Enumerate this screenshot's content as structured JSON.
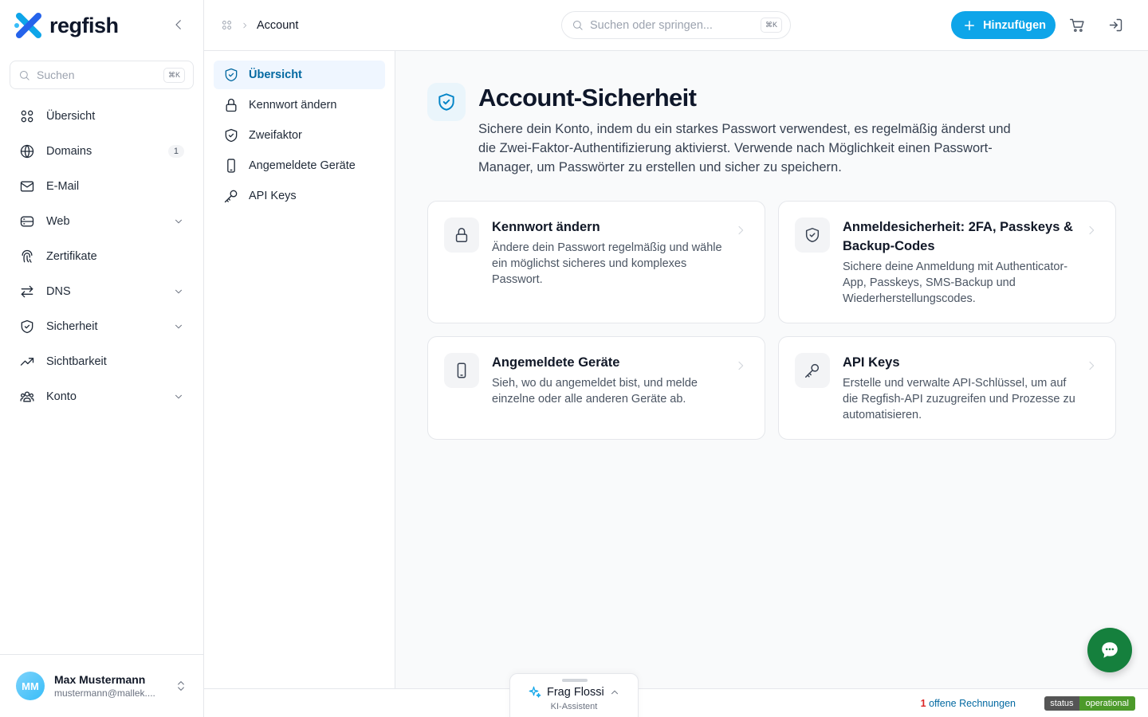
{
  "brand": {
    "name": "regfish"
  },
  "sidebar": {
    "search_placeholder": "Suchen",
    "search_shortcut": "⌘K",
    "items": [
      {
        "label": "Übersicht",
        "icon": "grid-icon"
      },
      {
        "label": "Domains",
        "icon": "globe-icon",
        "badge": "1"
      },
      {
        "label": "E-Mail",
        "icon": "mail-icon"
      },
      {
        "label": "Web",
        "icon": "server-icon",
        "expandable": true
      },
      {
        "label": "Zertifikate",
        "icon": "fingerprint-icon"
      },
      {
        "label": "DNS",
        "icon": "arrows-icon",
        "expandable": true
      },
      {
        "label": "Sicherheit",
        "icon": "shield-icon",
        "expandable": true
      },
      {
        "label": "Sichtbarkeit",
        "icon": "trend-icon"
      },
      {
        "label": "Konto",
        "icon": "users-icon",
        "expandable": true
      }
    ]
  },
  "user": {
    "initials": "MM",
    "name": "Max Mustermann",
    "email": "mustermann@mallek...."
  },
  "topbar": {
    "breadcrumb": "Account",
    "search_placeholder": "Suchen oder springen...",
    "search_shortcut": "⌘K",
    "add_label": "Hinzufügen"
  },
  "subnav": {
    "items": [
      {
        "label": "Übersicht",
        "active": true
      },
      {
        "label": "Kennwort ändern"
      },
      {
        "label": "Zweifaktor"
      },
      {
        "label": "Angemeldete Geräte"
      },
      {
        "label": "API Keys"
      }
    ]
  },
  "main": {
    "title": "Account-Sicherheit",
    "description": "Sichere dein Konto, indem du ein starkes Passwort verwendest, es regelmäßig änderst und die Zwei-Faktor-Authentifizierung aktivierst. Verwende nach Möglichkeit einen Passwort-Manager, um Passwörter zu erstellen und sicher zu speichern.",
    "cards": [
      {
        "title": "Kennwort ändern",
        "desc": "Ändere dein Passwort regelmäßig und wähle ein möglichst sicheres und komplexes Passwort.",
        "icon": "lock-icon"
      },
      {
        "title": "Anmeldesicherheit: 2FA, Passkeys & Backup-Codes",
        "desc": "Sichere deine Anmeldung mit Authenticator-App, Passkeys, SMS-Backup und Wiederherstellungscodes.",
        "icon": "shield-check-icon"
      },
      {
        "title": "Angemeldete Geräte",
        "desc": "Sieh, wo du angemeldet bist, und melde einzelne oder alle anderen Geräte ab.",
        "icon": "phone-icon"
      },
      {
        "title": "API Keys",
        "desc": "Erstelle und verwalte API-Schlüssel, um auf die Regfish-API zuzugreifen und Prozesse zu automatisieren.",
        "icon": "key-icon"
      }
    ]
  },
  "footer": {
    "invoice_count": "1",
    "invoice_label": "offene Rechnungen",
    "status_key": "status",
    "status_value": "operational"
  },
  "assistant": {
    "title": "Frag Flossi",
    "subtitle": "KI-Assistent"
  },
  "colors": {
    "accent": "#0ea5e9",
    "chat": "#15803d",
    "status_ok": "#4c9a2a"
  }
}
